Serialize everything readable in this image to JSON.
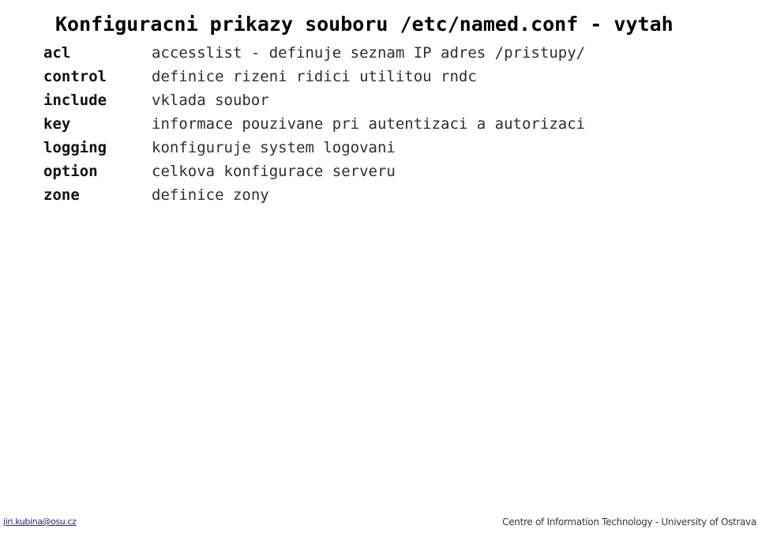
{
  "slide": {
    "title": "Konfiguracni prikazy souboru /etc/named.conf - vytah",
    "entries": [
      {
        "term": "acl",
        "description": "accesslist - definuje seznam IP adres /pristupy/"
      },
      {
        "term": "control",
        "description": "definice rizeni ridici utilitou rndc"
      },
      {
        "term": "include",
        "description": "vklada soubor"
      },
      {
        "term": "key",
        "description": "informace pouzivane pri autentizaci a autorizaci"
      },
      {
        "term": "logging",
        "description": "konfiguruje system logovani"
      },
      {
        "term": "option",
        "description": "celkova konfigurace serveru"
      },
      {
        "term": "zone",
        "description": "definice zony"
      }
    ]
  },
  "footer": {
    "email": "jiri.kubina@osu.cz",
    "organization": "Centre of Information Technology - University of Ostrava"
  },
  "colors": {
    "background": "#ffffff",
    "title_text": "#000000",
    "term_text": "#111111",
    "description_text": "#2e2e2e",
    "email_link": "#2a2a6e",
    "footer_text": "#3a3a3a"
  }
}
